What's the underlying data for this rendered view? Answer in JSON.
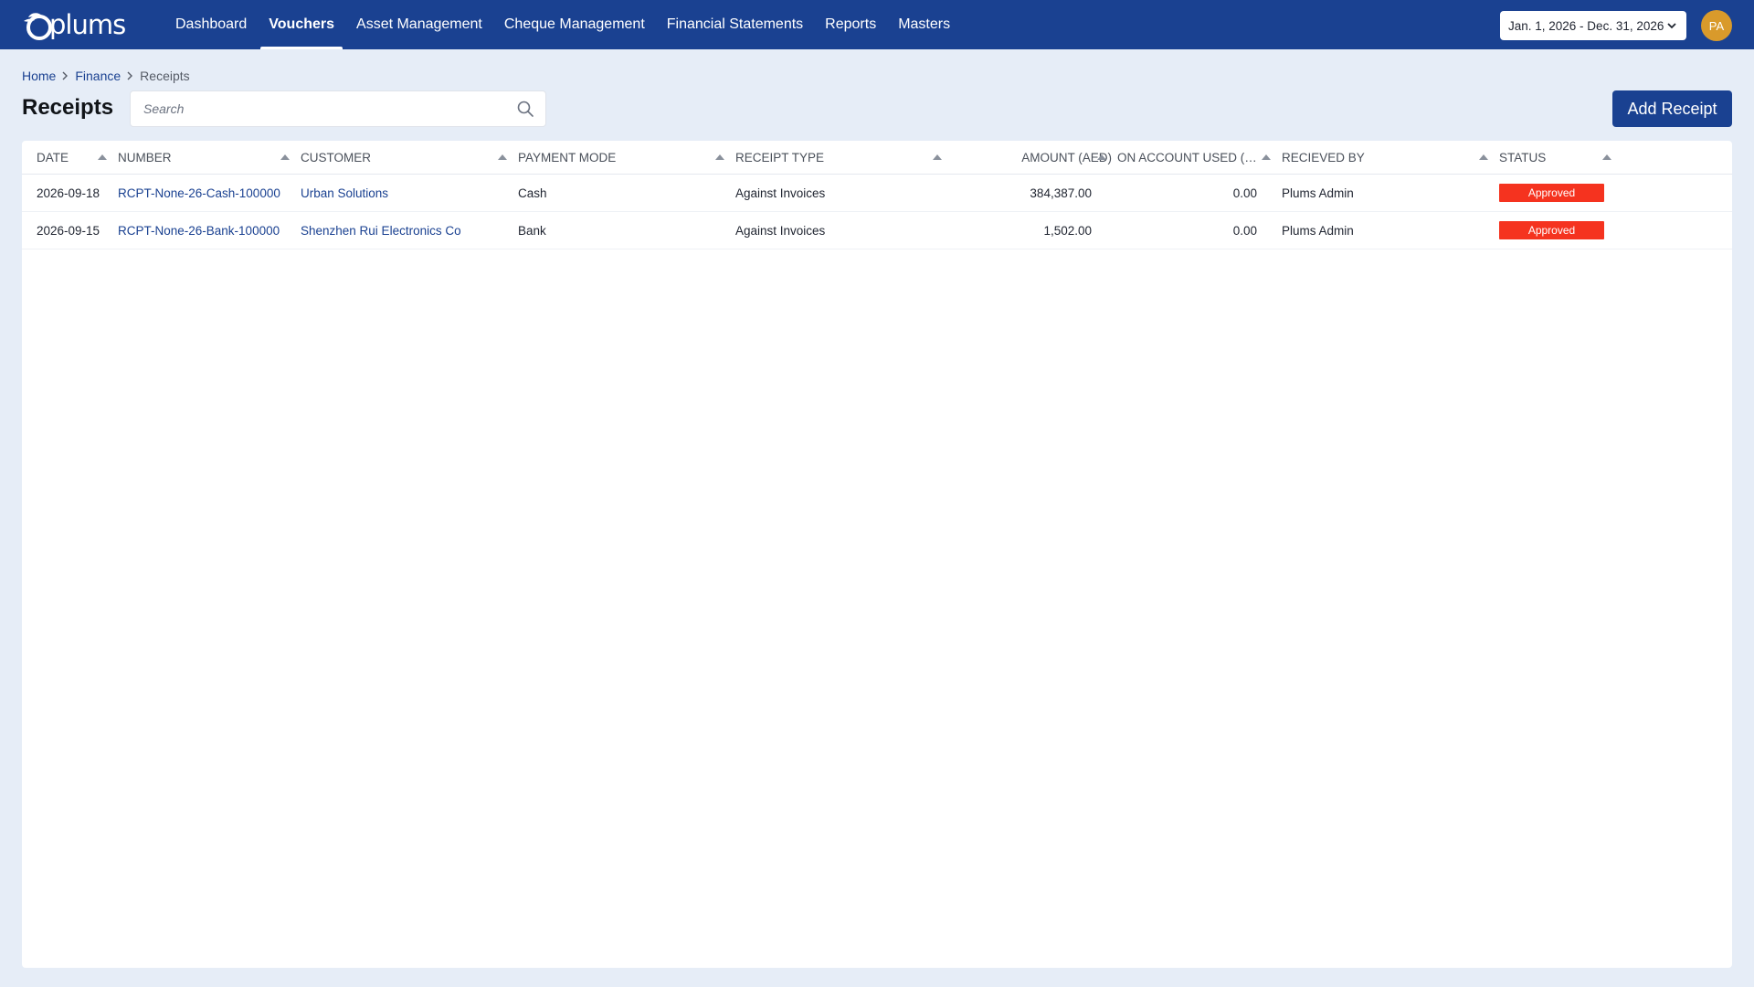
{
  "app": {
    "logo_text": "plums"
  },
  "nav": {
    "items": [
      {
        "label": "Dashboard",
        "active": false
      },
      {
        "label": "Vouchers",
        "active": true
      },
      {
        "label": "Asset Management",
        "active": false
      },
      {
        "label": "Cheque Management",
        "active": false
      },
      {
        "label": "Financial Statements",
        "active": false
      },
      {
        "label": "Reports",
        "active": false
      },
      {
        "label": "Masters",
        "active": false
      }
    ],
    "date_range": "Jan. 1, 2026 - Dec. 31, 2026",
    "avatar_initials": "PA"
  },
  "breadcrumb": {
    "home": "Home",
    "finance": "Finance",
    "current": "Receipts"
  },
  "page": {
    "title": "Receipts",
    "search_placeholder": "Search",
    "search_value": "",
    "add_button_label": "Add Receipt"
  },
  "table": {
    "columns": [
      "DATE",
      "NUMBER",
      "CUSTOMER",
      "PAYMENT MODE",
      "RECEIPT TYPE",
      "AMOUNT (AED)",
      "ON ACCOUNT USED (A...",
      "RECIEVED BY",
      "STATUS"
    ],
    "rows": [
      {
        "date": "2026-09-18",
        "number": "RCPT-None-26-Cash-100000",
        "customer": "Urban Solutions",
        "payment_mode": "Cash",
        "receipt_type": "Against Invoices",
        "amount": "384,387.00",
        "on_account_used": "0.00",
        "received_by": "Plums Admin",
        "status": "Approved"
      },
      {
        "date": "2026-09-15",
        "number": "RCPT-None-26-Bank-100000",
        "customer": "Shenzhen Rui Electronics Co",
        "payment_mode": "Bank",
        "receipt_type": "Against Invoices",
        "amount": "1,502.00",
        "on_account_used": "0.00",
        "received_by": "Plums Admin",
        "status": "Approved"
      }
    ]
  },
  "colors": {
    "brand": "#1a4191",
    "background": "#e6edf7",
    "status_approved": "#f5331f",
    "avatar": "#d99a2b"
  },
  "icons": {
    "search": "search-icon",
    "sort": "sort-asc-icon",
    "chevron": "chevron-down-icon"
  }
}
